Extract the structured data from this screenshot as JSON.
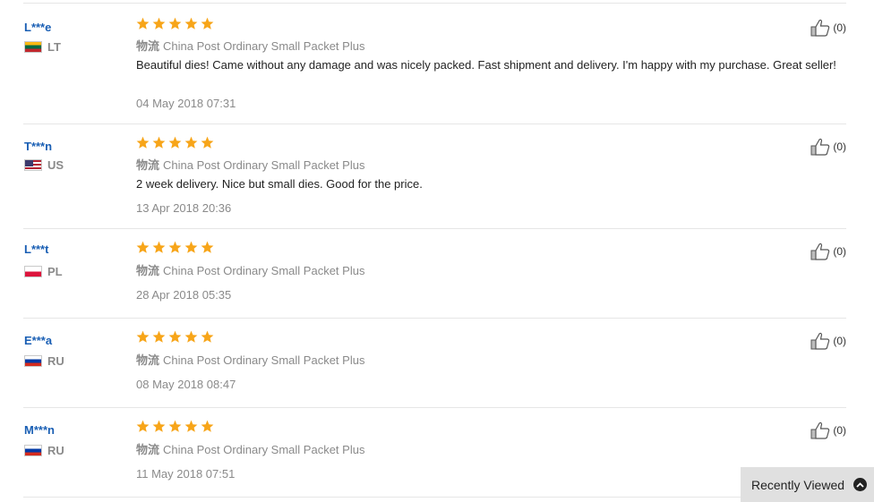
{
  "reviews": [
    {
      "user": "L***e",
      "country": "LT",
      "flag": "flag-lt",
      "rating": 5,
      "shipping_label": "物流",
      "shipping_method": "China Post Ordinary Small Packet Plus",
      "comment": "Beautiful dies! Came without any damage and was nicely packed. Fast shipment and delivery. I'm happy with my purchase. Great seller!",
      "date": "04 May 2018 07:31",
      "helpful_count": "(0)"
    },
    {
      "user": "T***n",
      "country": "US",
      "flag": "flag-us",
      "rating": 5,
      "shipping_label": "物流",
      "shipping_method": "China Post Ordinary Small Packet Plus",
      "comment": "2 week delivery. Nice but small dies. Good for the price.",
      "date": "13 Apr 2018 20:36",
      "helpful_count": "(0)"
    },
    {
      "user": "L***t",
      "country": "PL",
      "flag": "flag-pl",
      "rating": 5,
      "shipping_label": "物流",
      "shipping_method": "China Post Ordinary Small Packet Plus",
      "comment": "",
      "date": "28 Apr 2018 05:35",
      "helpful_count": "(0)"
    },
    {
      "user": "E***a",
      "country": "RU",
      "flag": "flag-ru",
      "rating": 5,
      "shipping_label": "物流",
      "shipping_method": "China Post Ordinary Small Packet Plus",
      "comment": "",
      "date": "08 May 2018 08:47",
      "helpful_count": "(0)"
    },
    {
      "user": "M***n",
      "country": "RU",
      "flag": "flag-ru",
      "rating": 5,
      "shipping_label": "物流",
      "shipping_method": "China Post Ordinary Small Packet Plus",
      "comment": "",
      "date": "11 May 2018 07:51",
      "helpful_count": "(0)"
    }
  ],
  "recently_viewed": {
    "label": "Recently Viewed",
    "icon": "chevron-up-circle-icon"
  },
  "colors": {
    "star": "#f7a519",
    "username": "#1a5fb4",
    "muted": "#8a8a8a"
  }
}
